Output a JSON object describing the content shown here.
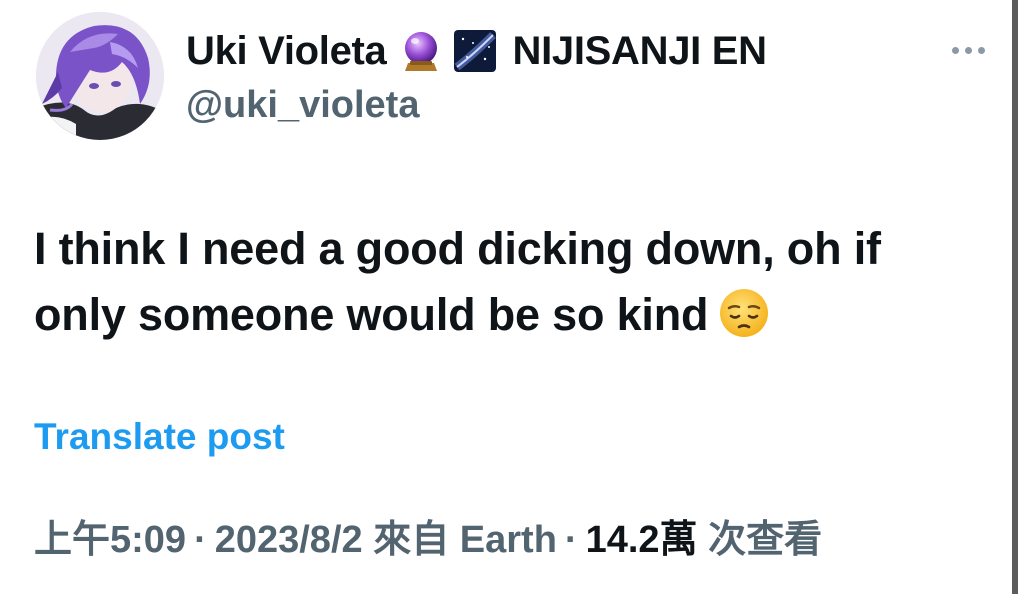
{
  "author": {
    "display_name": "Uki Violeta",
    "emoji_1": "crystal-ball-icon",
    "emoji_2": "milky-way-icon",
    "affiliation": "NIJISANJI EN",
    "handle": "@uki_violeta",
    "avatar": "avatar-icon"
  },
  "tweet": {
    "text_line_1": "I think I need a good dicking down, oh if",
    "text_line_2": "only someone would be so kind",
    "emoji": "pensive-face-icon"
  },
  "translate_label": "Translate post",
  "meta": {
    "time": "上午5:09",
    "separator": "·",
    "date": "2023/8/2",
    "from_prefix": "來自",
    "location": "Earth",
    "views_count": "14.2萬",
    "views_label": "次查看"
  },
  "colors": {
    "text": "#0f1419",
    "secondary": "#536471",
    "link": "#1d9bf0"
  },
  "icons": {
    "more": "more-horizontal-icon"
  }
}
